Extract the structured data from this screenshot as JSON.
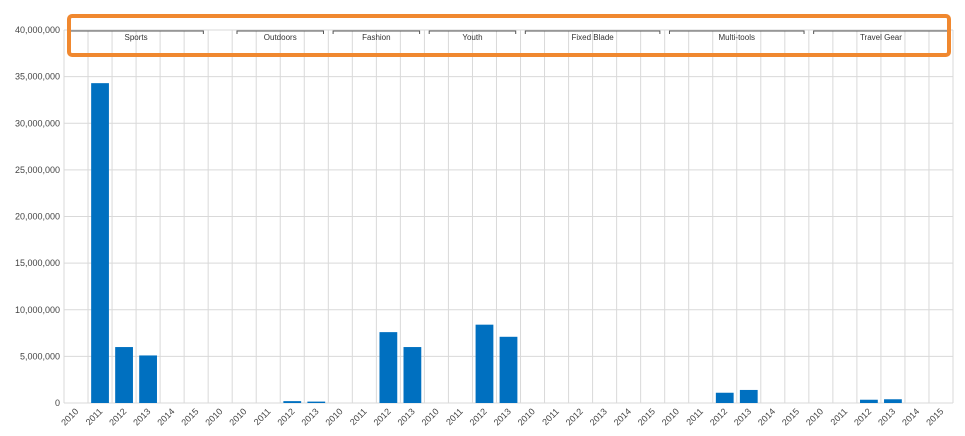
{
  "chart_data": {
    "type": "bar",
    "title": "",
    "xlabel": "",
    "ylabel": "",
    "ylim": [
      0,
      40000000
    ],
    "y_ticks": [
      "0",
      "5,000,000",
      "10,000,000",
      "15,000,000",
      "20,000,000",
      "25,000,000",
      "30,000,000",
      "35,000,000",
      "40,000,000"
    ],
    "y_tick_values": [
      0,
      5000000,
      10000000,
      15000000,
      20000000,
      25000000,
      30000000,
      35000000,
      40000000
    ],
    "grid": true,
    "bar_color": "#0070c0",
    "highlight_color": "#f0882f",
    "x_labels": [
      "2010",
      "2011",
      "2012",
      "2013",
      "2014",
      "2015",
      "2010",
      "2010",
      "2011",
      "2012",
      "2013",
      "2010",
      "2011",
      "2012",
      "2013",
      "2010",
      "2011",
      "2012",
      "2013",
      "2010",
      "2011",
      "2012",
      "2013",
      "2014",
      "2015",
      "2010",
      "2011",
      "2012",
      "2013",
      "2014",
      "2015",
      "2010",
      "2011",
      "2012",
      "2013",
      "2014",
      "2015"
    ],
    "values": [
      0,
      34300000,
      6000000,
      5100000,
      0,
      0,
      0,
      0,
      0,
      200000,
      150000,
      0,
      0,
      7600000,
      6000000,
      0,
      0,
      8400000,
      7100000,
      0,
      0,
      0,
      0,
      0,
      0,
      0,
      0,
      1100000,
      1400000,
      0,
      0,
      0,
      0,
      350000,
      400000,
      0,
      0
    ],
    "groups": [
      {
        "name": "Sports",
        "first_index": 0,
        "last_index": 5
      },
      {
        "name": "Outdoors",
        "first_index": 7,
        "last_index": 10
      },
      {
        "name": "Fashion",
        "first_index": 11,
        "last_index": 14
      },
      {
        "name": "Youth",
        "first_index": 15,
        "last_index": 18
      },
      {
        "name": "Fixed Blade",
        "first_index": 19,
        "last_index": 24
      },
      {
        "name": "Multi-tools",
        "first_index": 25,
        "last_index": 30
      },
      {
        "name": "Travel Gear",
        "first_index": 31,
        "last_index": 36
      }
    ]
  }
}
